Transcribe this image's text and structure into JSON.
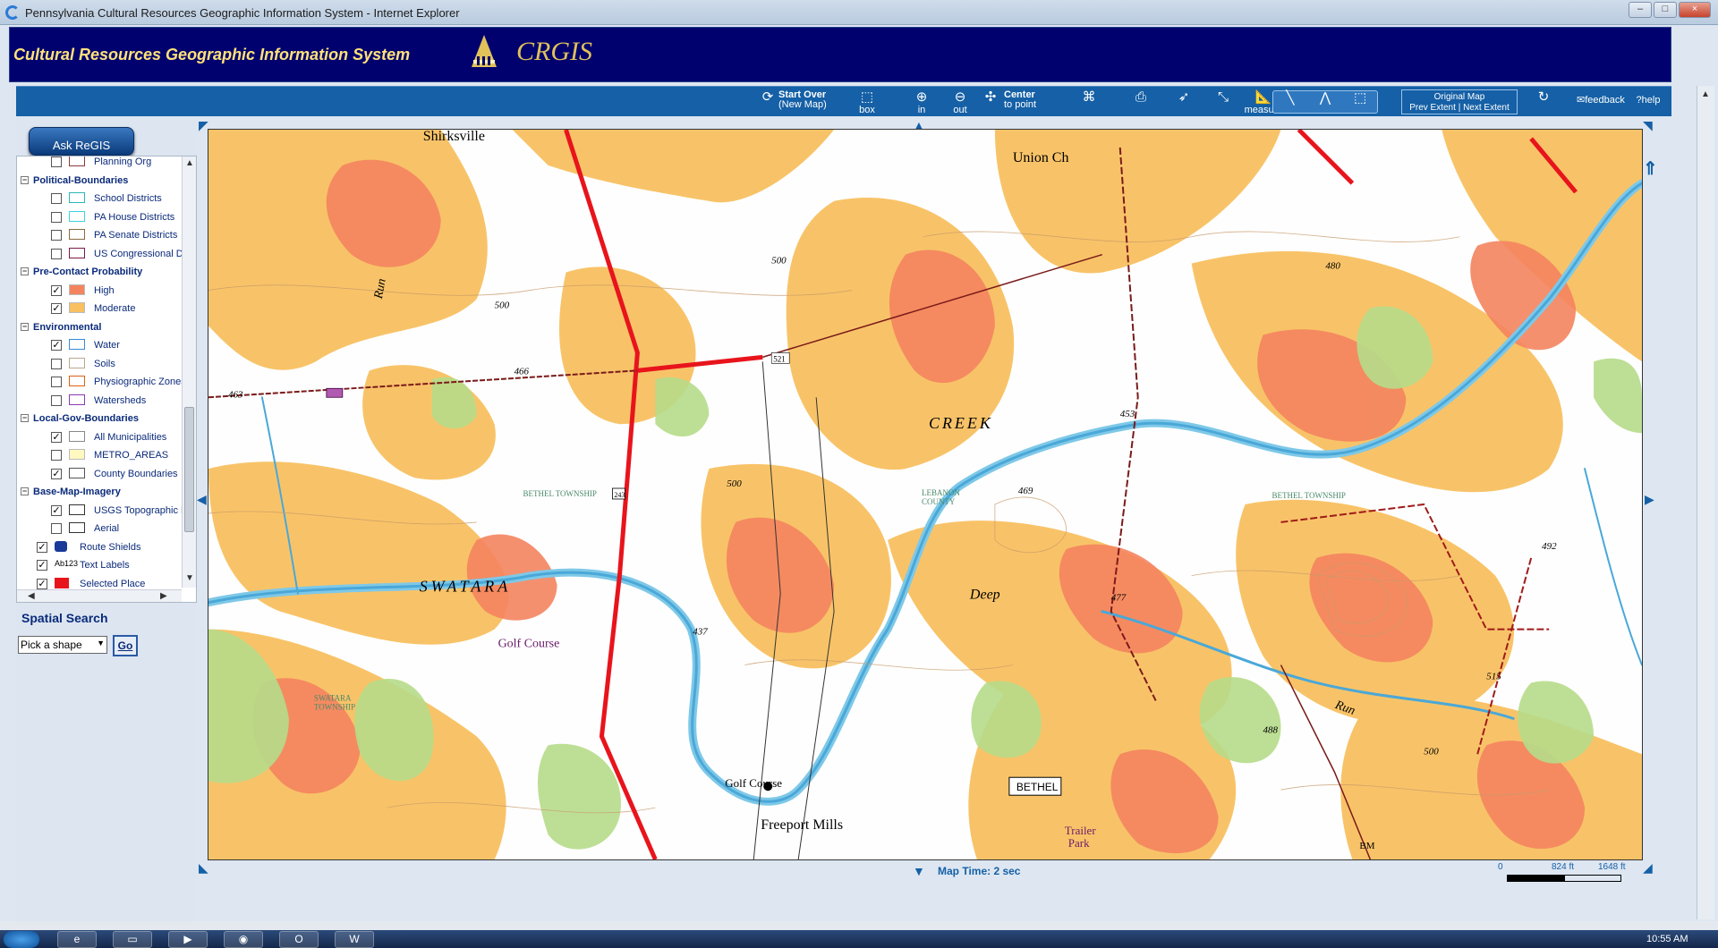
{
  "window": {
    "title": "Pennsylvania Cultural Resources Geographic Information System - Internet Explorer",
    "minimize": "–",
    "maximize": "□",
    "close": "×"
  },
  "banner": {
    "app_title": "Cultural Resources Geographic Information System",
    "logo_text": "CRGIS"
  },
  "toolbar": {
    "start_over": "Start Over",
    "start_over_sub": "(New Map)",
    "zoom_box": "box",
    "zoom_in": "in",
    "zoom_out": "out",
    "center": "Center",
    "center_sub": "to point",
    "measure": "measure",
    "original_map": "Original Map",
    "prev_extent": "Prev Extent",
    "next_extent": "Next Extent",
    "separator": "|",
    "feedback": "feedback",
    "help": "help"
  },
  "left": {
    "ask_regis": "Ask ReGIS",
    "spatial_search": "Spatial Search",
    "shape_select": "Pick a shape",
    "go": "Go"
  },
  "toc": [
    {
      "type": "layer",
      "label": "Planning Org",
      "checked": false,
      "swatch": "#8b3a3a"
    },
    {
      "type": "group",
      "label": "Political-Boundaries",
      "toggle": "−"
    },
    {
      "type": "layer",
      "label": "School Districts",
      "checked": false,
      "swatch": "#2ab7b7"
    },
    {
      "type": "layer",
      "label": "PA House Districts",
      "checked": false,
      "swatch": "#40d0e0"
    },
    {
      "type": "layer",
      "label": "PA Senate Districts",
      "checked": false,
      "swatch": "#8a6a40"
    },
    {
      "type": "layer",
      "label": "US Congressional Dis",
      "checked": false,
      "swatch": "#7a1a4a"
    },
    {
      "type": "group",
      "label": "Pre-Contact Probability",
      "toggle": "−"
    },
    {
      "type": "layer",
      "label": "High",
      "checked": true,
      "swatch": "#f4845f",
      "fill": true
    },
    {
      "type": "layer",
      "label": "Moderate",
      "checked": true,
      "swatch": "#f8c060",
      "fill": true
    },
    {
      "type": "group",
      "label": "Environmental",
      "toggle": "−"
    },
    {
      "type": "layer",
      "label": "Water",
      "checked": true,
      "swatch": "#3a8ad8"
    },
    {
      "type": "layer",
      "label": "Soils",
      "checked": false,
      "swatch": "#b8a890"
    },
    {
      "type": "layer",
      "label": "Physiographic Zones",
      "checked": false,
      "swatch": "#e06010"
    },
    {
      "type": "layer",
      "label": "Watersheds",
      "checked": false,
      "swatch": "#8a3ab0"
    },
    {
      "type": "group",
      "label": "Local-Gov-Boundaries",
      "toggle": "−"
    },
    {
      "type": "layer",
      "label": "All Municipalities",
      "checked": true,
      "swatch": "#888888"
    },
    {
      "type": "layer",
      "label": "METRO_AREAS",
      "checked": false,
      "swatch": "#fff8c0",
      "fill": true
    },
    {
      "type": "layer",
      "label": "County Boundaries",
      "checked": true,
      "swatch": "#555555"
    },
    {
      "type": "group",
      "label": "Base-Map-Imagery",
      "toggle": "−"
    },
    {
      "type": "layer",
      "label": "USGS Topographic M",
      "checked": true,
      "swatch": "#333333"
    },
    {
      "type": "layer",
      "label": "Aerial",
      "checked": false,
      "swatch": "#333333"
    },
    {
      "type": "root",
      "label": "Route Shields",
      "checked": true,
      "icon": "I-95"
    },
    {
      "type": "root",
      "label": "Text Labels",
      "checked": true,
      "icon": "Ab123"
    },
    {
      "type": "root",
      "label": "Selected Place",
      "checked": true,
      "icon": "pin"
    }
  ],
  "map": {
    "labels": {
      "shirksville": "Shirksville",
      "union": "Union Ch",
      "creek": "CREEK",
      "swatara": "SWATARA",
      "deep": "Deep",
      "golf1": "Golf Course",
      "golf2": "Golf Course",
      "freeport": "Freeport Mills",
      "trailer": "Trailer",
      "park": "Park",
      "run": "Run",
      "run2": "Run",
      "bethel_twp": "BETHEL TOWNSHIP",
      "bethel_twp_short": "BETHEL TOWNSHIP",
      "lebanon": "LEBANON",
      "county": "COUNTY",
      "swatara_twp": "SWATARA",
      "township": "TOWNSHIP",
      "route243": "243",
      "route521": "521",
      "e500a": "500",
      "e500b": "500",
      "e500c": "500",
      "e500d": "500",
      "e480": "480",
      "e453": "453",
      "e463": "463",
      "e437": "437",
      "e469": "469",
      "e477": "477",
      "e492": "492",
      "e488": "488",
      "e515": "515",
      "e466": "466",
      "bm": "BM"
    },
    "selected_place": "BETHEL",
    "map_time": "Map Time: 2 sec",
    "scale": {
      "zero": "0",
      "mid": "824 ft",
      "end": "1648 ft"
    }
  },
  "taskbar": {
    "clock": "10:55 AM"
  },
  "colors": {
    "banner_bg": "#00006e",
    "toolbar_bg": "#1560a6",
    "high": "#f4845f",
    "moderate": "#f8c060",
    "forest": "#b6dc8a",
    "water": "#7ec8e8",
    "road": "#e8141c"
  }
}
